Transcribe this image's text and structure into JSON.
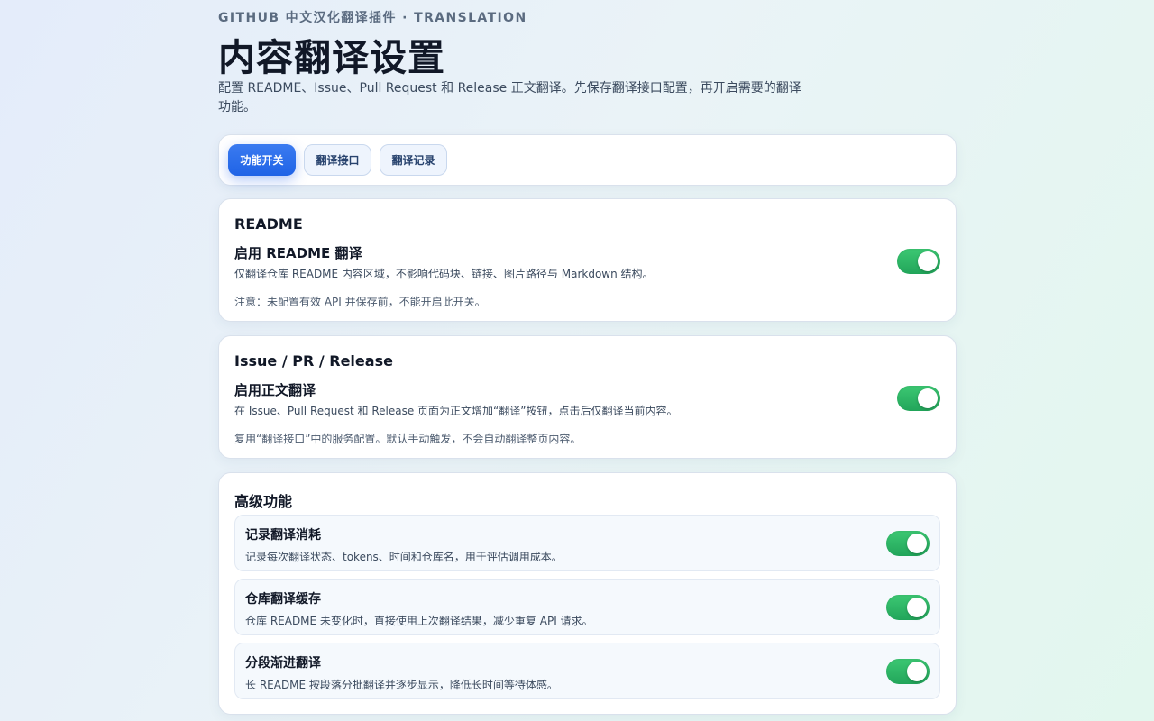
{
  "header": {
    "eyebrow": "GITHUB 中文汉化翻译插件 · TRANSLATION",
    "title": "内容翻译设置",
    "subtitle": "配置 README、Issue、Pull Request 和 Release 正文翻译。先保存翻译接口配置，再开启需要的翻译功能。"
  },
  "tabs": [
    {
      "label": "功能开关",
      "active": true
    },
    {
      "label": "翻译接口",
      "active": false
    },
    {
      "label": "翻译记录",
      "active": false
    }
  ],
  "readme_card": {
    "title": "README",
    "setting_title": "启用 README 翻译",
    "setting_desc": "仅翻译仓库 README 内容区域，不影响代码块、链接、图片路径与 Markdown 结构。",
    "note": "注意：未配置有效 API 并保存前，不能开启此开关。",
    "enabled": true
  },
  "issue_card": {
    "title": "Issue / PR / Release",
    "setting_title": "启用正文翻译",
    "setting_desc": "在 Issue、Pull Request 和 Release 页面为正文增加“翻译”按钮，点击后仅翻译当前内容。",
    "note": "复用“翻译接口”中的服务配置。默认手动触发，不会自动翻译整页内容。",
    "enabled": true
  },
  "advanced_card": {
    "title": "高级功能",
    "items": [
      {
        "title": "记录翻译消耗",
        "desc": "记录每次翻译状态、tokens、时间和仓库名，用于评估调用成本。",
        "enabled": true
      },
      {
        "title": "仓库翻译缓存",
        "desc": "仓库 README 未变化时，直接使用上次翻译结果，减少重复 API 请求。",
        "enabled": true
      },
      {
        "title": "分段渐进翻译",
        "desc": "长 README 按段落分批翻译并逐步显示，降低长时间等待体感。",
        "enabled": true
      }
    ]
  },
  "colors": {
    "accent": "#2563eb",
    "toggle_on": "#22a55a"
  }
}
